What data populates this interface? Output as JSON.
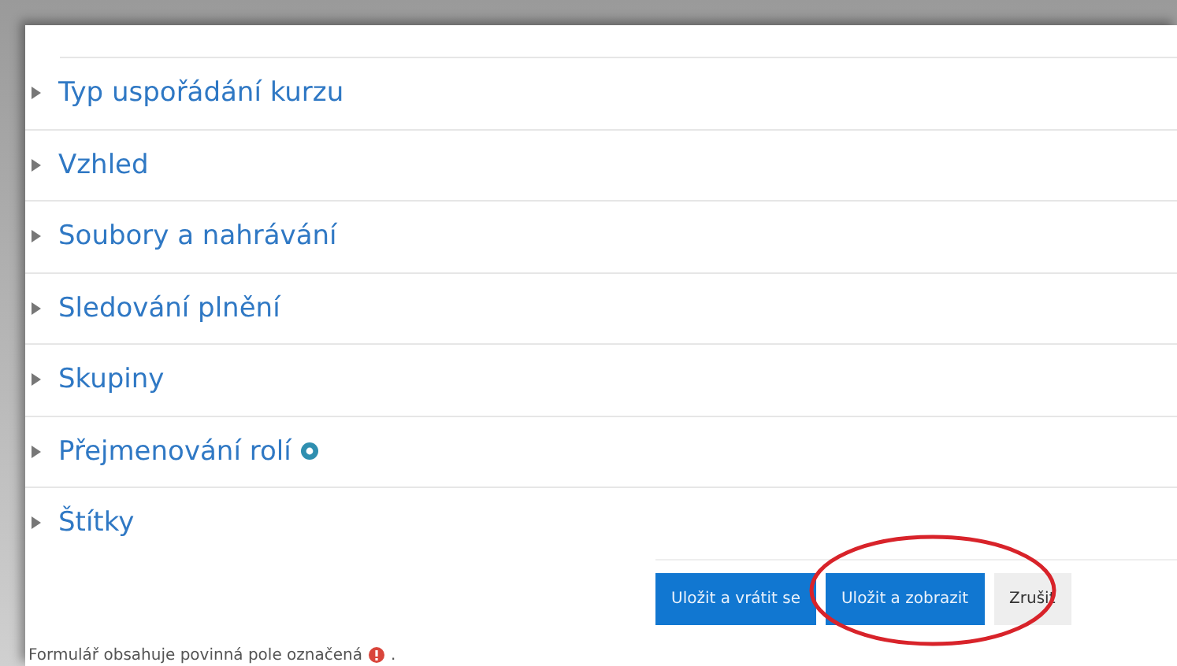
{
  "sections": [
    {
      "label": "Typ uspořádání kurzu",
      "expanded": false,
      "help": false
    },
    {
      "label": "Vzhled",
      "expanded": false,
      "help": false
    },
    {
      "label": "Soubory a nahrávání",
      "expanded": false,
      "help": false
    },
    {
      "label": "Sledování plnění",
      "expanded": false,
      "help": false
    },
    {
      "label": "Skupiny",
      "expanded": false,
      "help": false
    },
    {
      "label": "Přejmenování rolí",
      "expanded": false,
      "help": true
    },
    {
      "label": "Štítky",
      "expanded": false,
      "help": false
    }
  ],
  "buttons": [
    {
      "label": "Uložit a vrátit se",
      "kind": "primary"
    },
    {
      "label": "Uložit a zobrazit",
      "kind": "primary"
    },
    {
      "label": "Zrušit",
      "kind": "secondary"
    }
  ],
  "footer": {
    "text": "Formulář obsahuje povinná pole označená",
    "suffix": "."
  }
}
